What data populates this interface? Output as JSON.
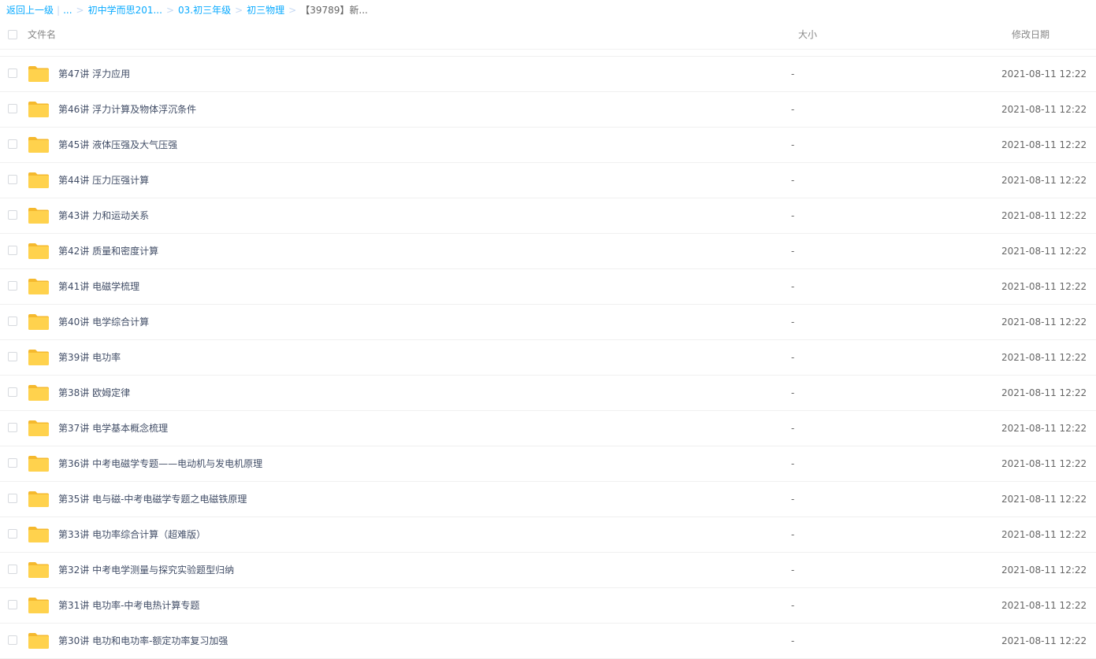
{
  "breadcrumb": {
    "back": "返回上一级",
    "ellipsis": "...",
    "items": [
      "初中学而思201...",
      "03.初三年级",
      "初三物理"
    ],
    "current": "【39789】新..."
  },
  "table": {
    "col_name": "文件名",
    "col_size": "大小",
    "col_date": "修改日期"
  },
  "rows": [
    {
      "name": "第47讲 浮力应用",
      "size": "-",
      "date": "2021-08-11 12:22"
    },
    {
      "name": "第46讲 浮力计算及物体浮沉条件",
      "size": "-",
      "date": "2021-08-11 12:22"
    },
    {
      "name": "第45讲 液体压强及大气压强",
      "size": "-",
      "date": "2021-08-11 12:22"
    },
    {
      "name": "第44讲 压力压强计算",
      "size": "-",
      "date": "2021-08-11 12:22"
    },
    {
      "name": "第43讲 力和运动关系",
      "size": "-",
      "date": "2021-08-11 12:22"
    },
    {
      "name": "第42讲 质量和密度计算",
      "size": "-",
      "date": "2021-08-11 12:22"
    },
    {
      "name": "第41讲 电磁学梳理",
      "size": "-",
      "date": "2021-08-11 12:22"
    },
    {
      "name": "第40讲 电学综合计算",
      "size": "-",
      "date": "2021-08-11 12:22"
    },
    {
      "name": "第39讲 电功率",
      "size": "-",
      "date": "2021-08-11 12:22"
    },
    {
      "name": "第38讲 欧姆定律",
      "size": "-",
      "date": "2021-08-11 12:22"
    },
    {
      "name": "第37讲 电学基本概念梳理",
      "size": "-",
      "date": "2021-08-11 12:22"
    },
    {
      "name": "第36讲 中考电磁学专题——电动机与发电机原理",
      "size": "-",
      "date": "2021-08-11 12:22"
    },
    {
      "name": "第35讲 电与磁-中考电磁学专题之电磁铁原理",
      "size": "-",
      "date": "2021-08-11 12:22"
    },
    {
      "name": "第33讲 电功率综合计算（超难版）",
      "size": "-",
      "date": "2021-08-11 12:22"
    },
    {
      "name": "第32讲 中考电学测量与探究实验题型归纳",
      "size": "-",
      "date": "2021-08-11 12:22"
    },
    {
      "name": "第31讲 电功率-中考电热计算专题",
      "size": "-",
      "date": "2021-08-11 12:22"
    },
    {
      "name": "第30讲 电功和电功率-额定功率复习加强",
      "size": "-",
      "date": "2021-08-11 12:22"
    }
  ],
  "colors": {
    "link": "#09aaff",
    "folder": "#ffd24d",
    "folder_tab": "#f5b92e"
  }
}
